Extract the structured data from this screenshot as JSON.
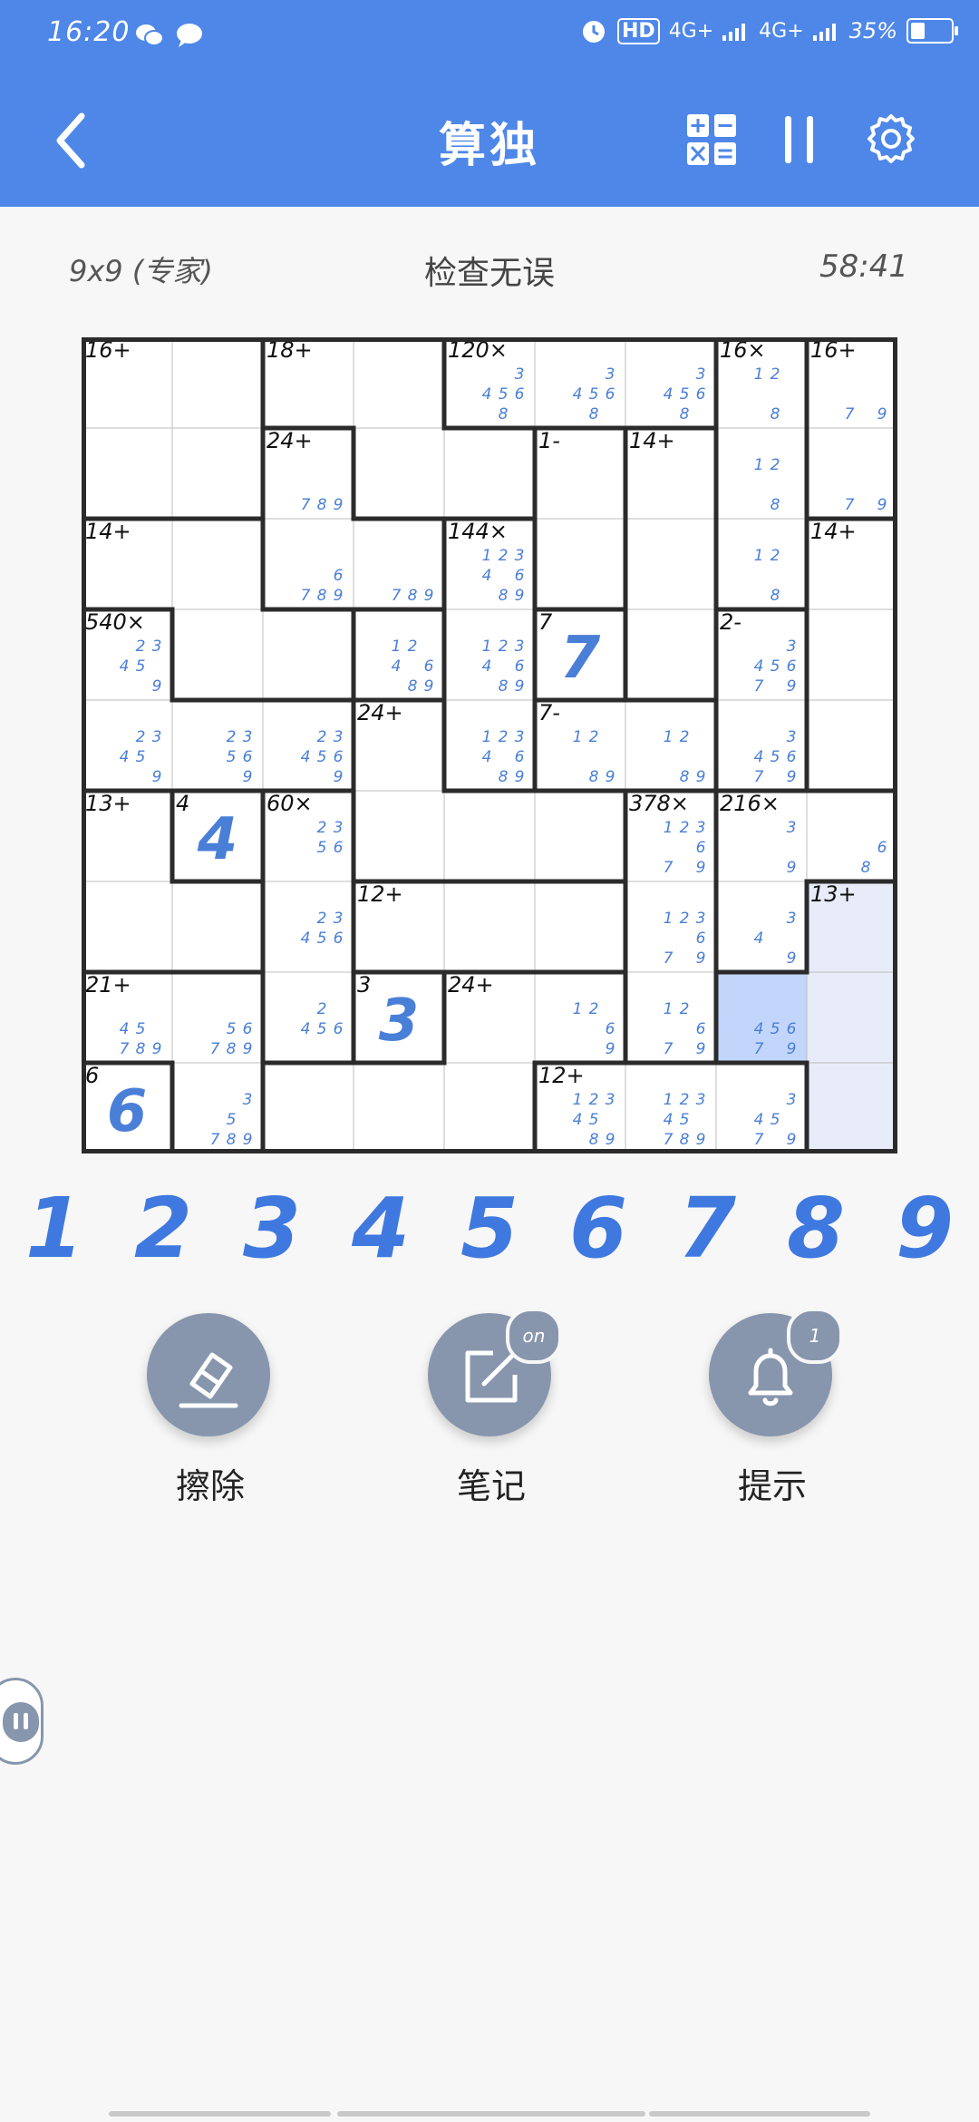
{
  "status_bar": {
    "time": "16:20",
    "hd_label": "HD",
    "sim1_label": "4G+",
    "sim2_label": "4G+",
    "battery": "35%",
    "battery_level": 0.35
  },
  "header": {
    "title": "算独",
    "back_icon": "chevron-left-icon",
    "operations_icon": "calculator-grid-icon",
    "pause_icon": "pause-icon",
    "settings_icon": "gear-icon"
  },
  "info": {
    "mode": "9x9 (专家)",
    "status": "检查无误",
    "timer": "58:41"
  },
  "board": {
    "size": 9,
    "selected_cell": [
      7,
      7
    ],
    "highlight_color": "#e7ecf8",
    "selected_color": "#c2d6fb",
    "cages": [
      {
        "label": "16+",
        "cells": [
          [
            0,
            0
          ],
          [
            0,
            1
          ],
          [
            1,
            0
          ],
          [
            1,
            1
          ]
        ]
      },
      {
        "label": "18+",
        "cells": [
          [
            0,
            2
          ],
          [
            0,
            3
          ],
          [
            1,
            3
          ],
          [
            1,
            4
          ],
          [
            2,
            4
          ]
        ]
      },
      {
        "label": "120×",
        "cells": [
          [
            0,
            4
          ],
          [
            0,
            5
          ],
          [
            0,
            6
          ]
        ]
      },
      {
        "label": "16×",
        "cells": [
          [
            0,
            7
          ],
          [
            1,
            7
          ],
          [
            2,
            7
          ]
        ]
      },
      {
        "label": "16+",
        "cells": [
          [
            0,
            8
          ],
          [
            1,
            8
          ]
        ]
      },
      {
        "label": "24+",
        "cells": [
          [
            1,
            2
          ],
          [
            2,
            2
          ],
          [
            2,
            3
          ]
        ]
      },
      {
        "label": "1-",
        "cells": [
          [
            1,
            5
          ],
          [
            2,
            5
          ]
        ]
      },
      {
        "label": "14+",
        "cells": [
          [
            1,
            6
          ],
          [
            2,
            6
          ],
          [
            3,
            6
          ]
        ]
      },
      {
        "label": "14+",
        "cells": [
          [
            2,
            0
          ],
          [
            2,
            1
          ],
          [
            3,
            1
          ],
          [
            3,
            2
          ]
        ]
      },
      {
        "label": "144×",
        "cells": [
          [
            2,
            4
          ],
          [
            3,
            4
          ],
          [
            4,
            4
          ]
        ]
      },
      {
        "label": "14+",
        "cells": [
          [
            2,
            8
          ],
          [
            3,
            8
          ],
          [
            4,
            8
          ]
        ]
      },
      {
        "label": "540×",
        "cells": [
          [
            3,
            0
          ],
          [
            4,
            0
          ],
          [
            4,
            1
          ],
          [
            4,
            2
          ]
        ]
      },
      {
        "label": "12+",
        "cells": [
          [
            3,
            3
          ],
          [
            3,
            3
          ]
        ]
      },
      {
        "label": "7",
        "cells": [
          [
            3,
            5
          ]
        ]
      },
      {
        "label": "2-",
        "cells": [
          [
            3,
            7
          ],
          [
            4,
            7
          ]
        ]
      },
      {
        "label": "24+",
        "cells": [
          [
            4,
            3
          ],
          [
            5,
            3
          ],
          [
            5,
            4
          ],
          [
            5,
            5
          ]
        ]
      },
      {
        "label": "7-",
        "cells": [
          [
            4,
            5
          ],
          [
            4,
            6
          ]
        ]
      },
      {
        "label": "13+",
        "cells": [
          [
            5,
            0
          ],
          [
            6,
            0
          ],
          [
            6,
            1
          ]
        ]
      },
      {
        "label": "4",
        "cells": [
          [
            5,
            1
          ]
        ]
      },
      {
        "label": "60×",
        "cells": [
          [
            5,
            2
          ],
          [
            6,
            2
          ],
          [
            7,
            2
          ]
        ]
      },
      {
        "label": "378×",
        "cells": [
          [
            5,
            6
          ],
          [
            6,
            6
          ],
          [
            7,
            6
          ]
        ]
      },
      {
        "label": "216×",
        "cells": [
          [
            5,
            7
          ],
          [
            5,
            8
          ],
          [
            6,
            7
          ]
        ]
      },
      {
        "label": "12+",
        "cells": [
          [
            6,
            3
          ],
          [
            6,
            4
          ],
          [
            6,
            5
          ]
        ]
      },
      {
        "label": "13+",
        "cells": [
          [
            6,
            8
          ],
          [
            7,
            7
          ],
          [
            7,
            8
          ],
          [
            8,
            8
          ]
        ]
      },
      {
        "label": "21+",
        "cells": [
          [
            7,
            0
          ],
          [
            7,
            1
          ],
          [
            8,
            1
          ]
        ]
      },
      {
        "label": "3",
        "cells": [
          [
            7,
            3
          ]
        ]
      },
      {
        "label": "24+",
        "cells": [
          [
            7,
            4
          ],
          [
            8,
            2
          ],
          [
            8,
            3
          ],
          [
            8,
            4
          ],
          [
            7,
            5
          ]
        ]
      },
      {
        "label": "6",
        "cells": [
          [
            8,
            0
          ]
        ]
      },
      {
        "label": "12+",
        "cells": [
          [
            8,
            5
          ],
          [
            8,
            6
          ],
          [
            8,
            7
          ]
        ]
      }
    ],
    "labels": [
      {
        "r": 0,
        "c": 0,
        "text": "16+"
      },
      {
        "r": 0,
        "c": 2,
        "text": "18+"
      },
      {
        "r": 0,
        "c": 4,
        "text": "120×"
      },
      {
        "r": 0,
        "c": 7,
        "text": "16×"
      },
      {
        "r": 0,
        "c": 8,
        "text": "16+"
      },
      {
        "r": 1,
        "c": 2,
        "text": "24+"
      },
      {
        "r": 1,
        "c": 5,
        "text": "1-"
      },
      {
        "r": 1,
        "c": 6,
        "text": "14+"
      },
      {
        "r": 2,
        "c": 0,
        "text": "14+"
      },
      {
        "r": 2,
        "c": 4,
        "text": "144×"
      },
      {
        "r": 2,
        "c": 8,
        "text": "14+"
      },
      {
        "r": 3,
        "c": 0,
        "text": "540×"
      },
      {
        "r": 3,
        "c": 5,
        "text": "7"
      },
      {
        "r": 3,
        "c": 7,
        "text": "2-"
      },
      {
        "r": 4,
        "c": 3,
        "text": "24+"
      },
      {
        "r": 4,
        "c": 5,
        "text": "7-"
      },
      {
        "r": 5,
        "c": 0,
        "text": "13+"
      },
      {
        "r": 5,
        "c": 1,
        "text": "4"
      },
      {
        "r": 5,
        "c": 2,
        "text": "60×"
      },
      {
        "r": 5,
        "c": 6,
        "text": "378×"
      },
      {
        "r": 5,
        "c": 7,
        "text": "216×"
      },
      {
        "r": 6,
        "c": 3,
        "text": "12+"
      },
      {
        "r": 6,
        "c": 8,
        "text": "13+"
      },
      {
        "r": 7,
        "c": 0,
        "text": "21+"
      },
      {
        "r": 7,
        "c": 3,
        "text": "3"
      },
      {
        "r": 7,
        "c": 4,
        "text": "24+"
      },
      {
        "r": 8,
        "c": 0,
        "text": "6"
      },
      {
        "r": 8,
        "c": 5,
        "text": "12+"
      }
    ],
    "values": [
      {
        "r": 3,
        "c": 5,
        "value": "7"
      },
      {
        "r": 5,
        "c": 1,
        "value": "4"
      },
      {
        "r": 7,
        "c": 3,
        "value": "3"
      },
      {
        "r": 8,
        "c": 0,
        "value": "6"
      }
    ],
    "notes": [
      {
        "r": 0,
        "c": 4,
        "n": [
          3,
          4,
          5,
          6,
          8
        ]
      },
      {
        "r": 0,
        "c": 5,
        "n": [
          3,
          4,
          5,
          6,
          8
        ]
      },
      {
        "r": 0,
        "c": 6,
        "n": [
          3,
          4,
          5,
          6,
          8
        ]
      },
      {
        "r": 0,
        "c": 7,
        "n": [
          1,
          2,
          8
        ]
      },
      {
        "r": 0,
        "c": 8,
        "n": [
          7,
          9
        ]
      },
      {
        "r": 1,
        "c": 2,
        "n": [
          7,
          8,
          9
        ]
      },
      {
        "r": 1,
        "c": 7,
        "n": [
          1,
          2,
          8
        ]
      },
      {
        "r": 1,
        "c": 8,
        "n": [
          7,
          9
        ]
      },
      {
        "r": 2,
        "c": 2,
        "n": [
          6,
          7,
          8,
          9
        ]
      },
      {
        "r": 2,
        "c": 3,
        "n": [
          7,
          8,
          9
        ]
      },
      {
        "r": 2,
        "c": 4,
        "n": [
          1,
          2,
          3,
          4,
          6,
          8,
          9
        ]
      },
      {
        "r": 2,
        "c": 7,
        "n": [
          1,
          2,
          8
        ]
      },
      {
        "r": 3,
        "c": 0,
        "n": [
          2,
          3,
          4,
          5,
          9
        ]
      },
      {
        "r": 3,
        "c": 3,
        "n": [
          1,
          2,
          4,
          6,
          8,
          9
        ]
      },
      {
        "r": 3,
        "c": 4,
        "n": [
          1,
          2,
          3,
          4,
          6,
          8,
          9
        ]
      },
      {
        "r": 3,
        "c": 7,
        "n": [
          3,
          4,
          5,
          6,
          7,
          9
        ]
      },
      {
        "r": 4,
        "c": 0,
        "n": [
          2,
          3,
          4,
          5,
          9
        ]
      },
      {
        "r": 4,
        "c": 1,
        "n": [
          2,
          3,
          5,
          6,
          9
        ]
      },
      {
        "r": 4,
        "c": 2,
        "n": [
          2,
          3,
          4,
          5,
          6,
          9
        ]
      },
      {
        "r": 4,
        "c": 4,
        "n": [
          1,
          2,
          3,
          4,
          6,
          8,
          9
        ]
      },
      {
        "r": 4,
        "c": 5,
        "n": [
          1,
          2,
          8,
          9
        ]
      },
      {
        "r": 4,
        "c": 6,
        "n": [
          1,
          2,
          8,
          9
        ]
      },
      {
        "r": 4,
        "c": 7,
        "n": [
          3,
          4,
          5,
          6,
          7,
          9
        ]
      },
      {
        "r": 5,
        "c": 2,
        "n": [
          2,
          3,
          5,
          6
        ]
      },
      {
        "r": 5,
        "c": 6,
        "n": [
          1,
          2,
          3,
          6,
          7,
          9
        ]
      },
      {
        "r": 5,
        "c": 7,
        "n": [
          3,
          9
        ]
      },
      {
        "r": 5,
        "c": 8,
        "n": [
          6,
          8
        ]
      },
      {
        "r": 6,
        "c": 2,
        "n": [
          2,
          3,
          4,
          5,
          6
        ]
      },
      {
        "r": 6,
        "c": 6,
        "n": [
          1,
          2,
          3,
          6,
          7,
          9
        ]
      },
      {
        "r": 6,
        "c": 7,
        "n": [
          3,
          4,
          9
        ]
      },
      {
        "r": 7,
        "c": 0,
        "n": [
          4,
          5,
          7,
          8,
          9
        ]
      },
      {
        "r": 7,
        "c": 1,
        "n": [
          5,
          6,
          7,
          8,
          9
        ]
      },
      {
        "r": 7,
        "c": 2,
        "n": [
          2,
          4,
          5,
          6
        ]
      },
      {
        "r": 7,
        "c": 5,
        "n": [
          1,
          2,
          6,
          9
        ]
      },
      {
        "r": 7,
        "c": 6,
        "n": [
          1,
          2,
          6,
          7,
          9
        ]
      },
      {
        "r": 7,
        "c": 7,
        "n": [
          4,
          5,
          6,
          7,
          9
        ]
      },
      {
        "r": 8,
        "c": 1,
        "n": [
          3,
          5,
          7,
          8,
          9
        ]
      },
      {
        "r": 8,
        "c": 5,
        "n": [
          1,
          2,
          3,
          4,
          5,
          8,
          9
        ]
      },
      {
        "r": 8,
        "c": 6,
        "n": [
          1,
          2,
          3,
          4,
          5,
          7,
          8,
          9
        ]
      },
      {
        "r": 8,
        "c": 7,
        "n": [
          3,
          4,
          5,
          7,
          9
        ]
      }
    ]
  },
  "numpad": [
    "1",
    "2",
    "3",
    "4",
    "5",
    "6",
    "7",
    "8",
    "9"
  ],
  "actions": {
    "erase": {
      "label": "擦除",
      "icon": "eraser-icon"
    },
    "notes": {
      "label": "笔记",
      "icon": "edit-note-icon",
      "badge": "on"
    },
    "hint": {
      "label": "提示",
      "icon": "bell-icon",
      "badge": "1"
    }
  },
  "colors": {
    "accent": "#4e87e8",
    "digit": "#3f79e0",
    "action_button": "#8796ad"
  }
}
